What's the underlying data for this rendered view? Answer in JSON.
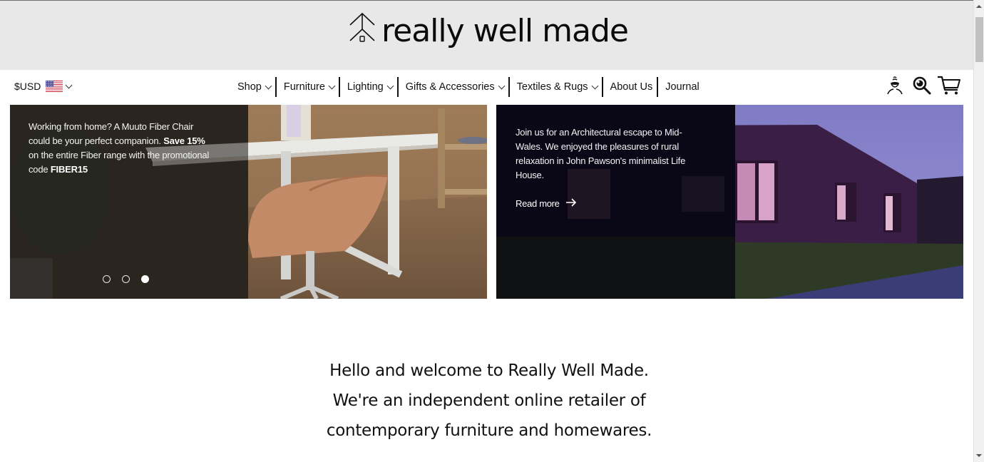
{
  "brand": {
    "name": "really well made",
    "logo_icon": "house-arrow-icon",
    "header_bg": "#e8e8e8"
  },
  "nav": {
    "currency": {
      "symbol": "$",
      "code": "USD",
      "flag": "us-flag-icon",
      "label": "$USD"
    },
    "menu": [
      {
        "label": "Shop",
        "has_dropdown": true
      },
      {
        "label": "Furniture",
        "has_dropdown": true
      },
      {
        "label": "Lighting",
        "has_dropdown": true
      },
      {
        "label": "Gifts & Accessories",
        "has_dropdown": true
      },
      {
        "label": "Textiles & Rugs",
        "has_dropdown": true
      },
      {
        "label": "About Us",
        "has_dropdown": false
      },
      {
        "label": "Journal",
        "has_dropdown": false
      }
    ],
    "icons": [
      "account-icon",
      "search-icon",
      "cart-icon"
    ]
  },
  "hero": {
    "left": {
      "text_1": "Working from home? A Muuto Fiber Chair could be your perfect companion. ",
      "bold_1": "Save 15%",
      "text_2": " on the entire Fiber range with the promotional code ",
      "bold_2": "FIBER15",
      "slides_total": 3,
      "active_slide": 3
    },
    "right": {
      "text": "Join us for an Architectural escape to Mid-Wales. We enjoyed the pleasures of rural relaxation in John Pawson's minimalist Life House.",
      "link_label": "Read more",
      "link_icon": "arrow-right-icon"
    }
  },
  "welcome": {
    "lines": [
      "Hello and welcome to Really Well Made.",
      "We're an independent online retailer of",
      "contemporary furniture and homewares."
    ]
  }
}
